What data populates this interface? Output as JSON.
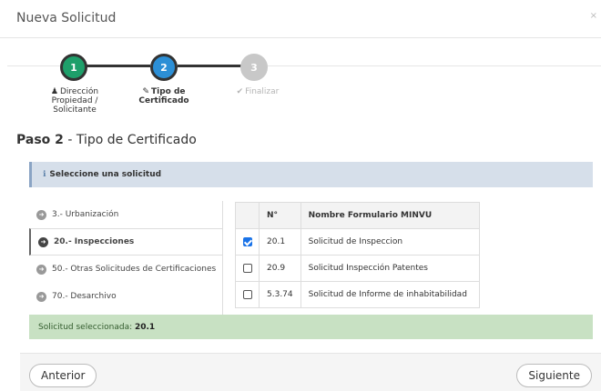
{
  "modal": {
    "title": "Nueva Solicitud",
    "close": "×"
  },
  "wizard": {
    "steps": [
      {
        "number": "1",
        "icon": "user-icon",
        "label": "Dirección Propiedad / Solicitante",
        "state": "done"
      },
      {
        "number": "2",
        "icon": "edit-icon",
        "label": "Tipo de Certificado",
        "state": "active"
      },
      {
        "number": "3",
        "icon": "check-icon",
        "label": "Finalizar",
        "state": "pending"
      }
    ]
  },
  "paso": {
    "prefix": "Paso 2",
    "suffix": " - Tipo de Certificado"
  },
  "info": {
    "icon": "info-icon",
    "text": "Seleccione una solicitud"
  },
  "tabs": [
    {
      "num": "3",
      "label": "3.- Urbanización",
      "active": false
    },
    {
      "num": "20",
      "label": "20.- Inspecciones",
      "active": true
    },
    {
      "num": "50",
      "label": "50.- Otras Solicitudes de Certificaciones",
      "active": false
    },
    {
      "num": "70",
      "label": "70.- Desarchivo",
      "active": false
    }
  ],
  "table": {
    "headers": [
      "",
      "N°",
      "Nombre Formulario MINVU"
    ],
    "rows": [
      {
        "checked": true,
        "num": "20.1",
        "name": "Solicitud de Inspeccion"
      },
      {
        "checked": false,
        "num": "20.9",
        "name": "Solicitud Inspección Patentes"
      },
      {
        "checked": false,
        "num": "5.3.74",
        "name": "Solicitud de Informe de inhabitabilidad"
      }
    ]
  },
  "selected": {
    "label": "Solicitud seleccionada: ",
    "value": "20.1"
  },
  "footer": {
    "prev": "Anterior",
    "next": "Siguiente"
  },
  "colors": {
    "step_done": "#1e9f6a",
    "step_active": "#2c8fd6",
    "step_pending": "#c8c8c8",
    "info_bg": "#d6dfea",
    "success_bg": "#c8e1c3"
  }
}
